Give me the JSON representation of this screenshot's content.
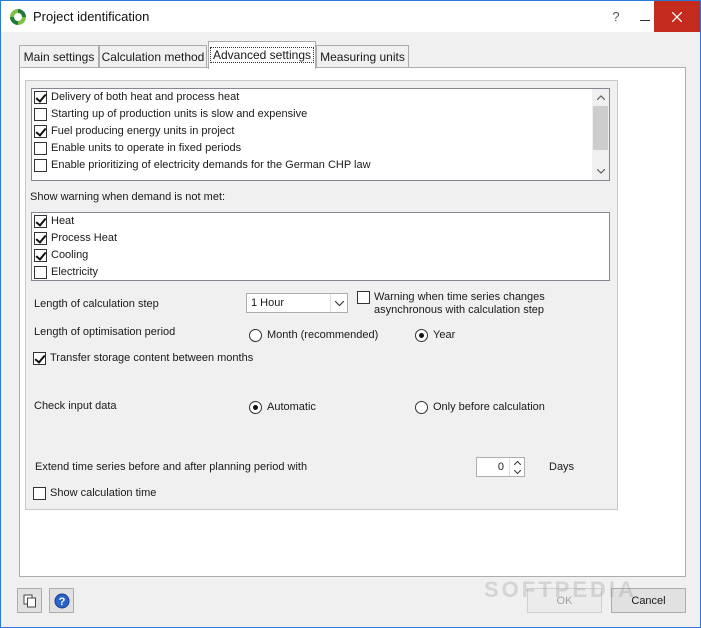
{
  "window": {
    "title": "Project identification",
    "help": "?"
  },
  "tabs": [
    {
      "label": "Main settings"
    },
    {
      "label": "Calculation method"
    },
    {
      "label": "Advanced settings"
    },
    {
      "label": "Measuring units"
    }
  ],
  "options_list": [
    {
      "label": "Delivery of both heat and process heat",
      "checked": true
    },
    {
      "label": "Starting up of production units is slow and expensive",
      "checked": false
    },
    {
      "label": "Fuel producing energy units in project",
      "checked": true
    },
    {
      "label": "Enable units to operate in fixed periods",
      "checked": false
    },
    {
      "label": "Enable prioritizing of electricity demands for the German CHP law",
      "checked": false
    }
  ],
  "warning_section": {
    "label": "Show warning when demand is not met:",
    "items": [
      {
        "label": "Heat",
        "checked": true
      },
      {
        "label": "Process Heat",
        "checked": true
      },
      {
        "label": "Cooling",
        "checked": true
      },
      {
        "label": "Electricity",
        "checked": false
      }
    ]
  },
  "calc_step": {
    "label": "Length of calculation step",
    "value": "1 Hour",
    "warning_line1": "Warning when time series changes",
    "warning_line2": "asynchronous with calculation step",
    "warning_checked": false
  },
  "optimisation": {
    "label": "Length of optimisation period",
    "option_month": "Month (recommended)",
    "option_year": "Year",
    "selected": "year"
  },
  "transfer_storage": {
    "label": "Transfer storage content between months",
    "checked": true
  },
  "check_input": {
    "label": "Check input data",
    "option_auto": "Automatic",
    "option_before": "Only before calculation",
    "selected": "automatic"
  },
  "extend": {
    "label": "Extend time series before and after planning period with",
    "value": "0",
    "unit": "Days"
  },
  "show_calc_time": {
    "label": "Show calculation time",
    "checked": false
  },
  "buttons": {
    "ok": "OK",
    "cancel": "Cancel"
  },
  "watermark": "SOFTPEDIA"
}
